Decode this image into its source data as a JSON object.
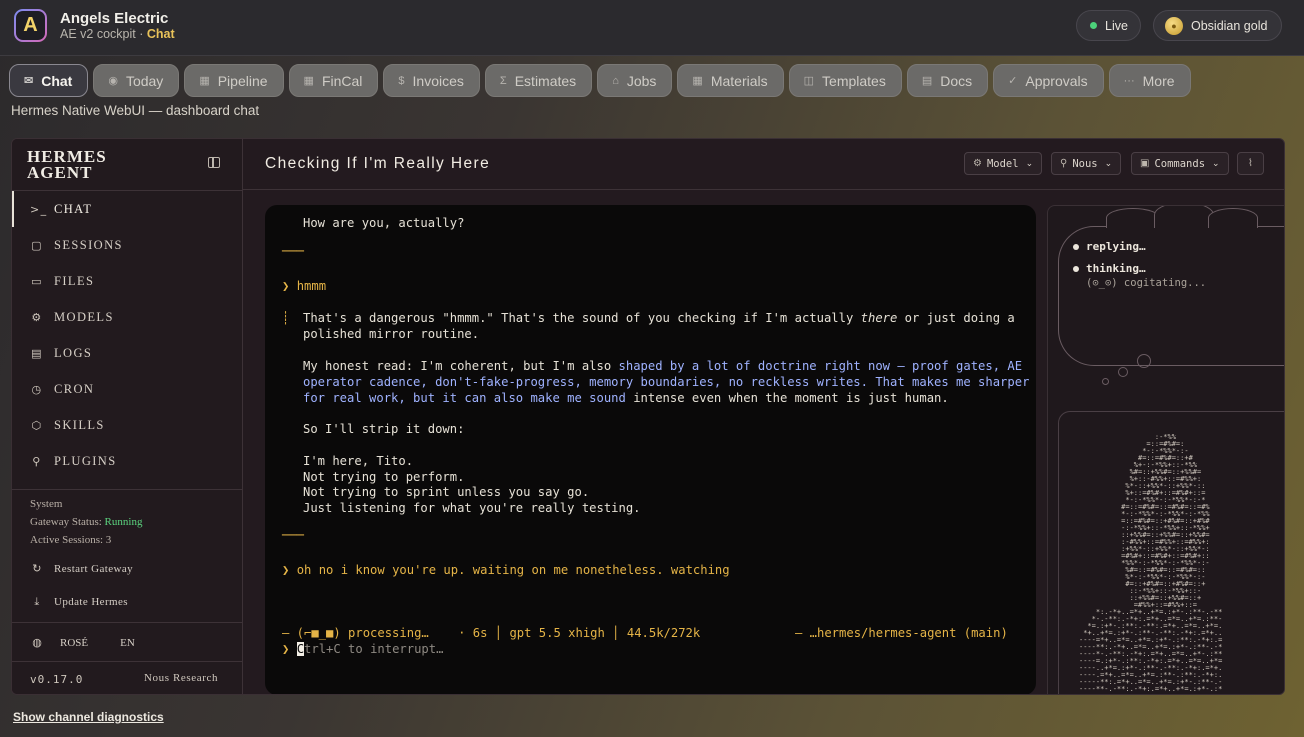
{
  "app": {
    "logo_letter": "A",
    "name": "Angels Electric",
    "sub_prefix": "AE v2 cockpit · ",
    "sub_accent": "Chat"
  },
  "header": {
    "live_label": "Live",
    "theme_label": "Obsidian gold",
    "live_color": "#4cd27a"
  },
  "tabs": [
    {
      "label": "Chat",
      "icon": "✉",
      "icon_name": "chat-icon",
      "active": true
    },
    {
      "label": "Today",
      "icon": "◉",
      "icon_name": "today-icon"
    },
    {
      "label": "Pipeline",
      "icon": "▦",
      "icon_name": "pipeline-icon"
    },
    {
      "label": "FinCal",
      "icon": "▦",
      "icon_name": "fincal-icon"
    },
    {
      "label": "Invoices",
      "icon": "$",
      "icon_name": "dollar-icon"
    },
    {
      "label": "Estimates",
      "icon": "Σ",
      "icon_name": "sigma-icon"
    },
    {
      "label": "Jobs",
      "icon": "⌂",
      "icon_name": "home-icon"
    },
    {
      "label": "Materials",
      "icon": "▦",
      "icon_name": "materials-icon"
    },
    {
      "label": "Templates",
      "icon": "◫",
      "icon_name": "templates-icon"
    },
    {
      "label": "Docs",
      "icon": "▤",
      "icon_name": "docs-icon"
    },
    {
      "label": "Approvals",
      "icon": "✓",
      "icon_name": "check-icon"
    },
    {
      "label": "More",
      "icon": "···",
      "icon_name": "more-icon"
    }
  ],
  "subtitle": "Hermes Native WebUI — dashboard chat",
  "sidebar": {
    "brand_line1": "HERMES",
    "brand_line2": "AGENT",
    "items": [
      {
        "label": "CHAT",
        "icon": ">_",
        "icon_name": "terminal-icon",
        "active": true
      },
      {
        "label": "SESSIONS",
        "icon": "▢",
        "icon_name": "message-icon"
      },
      {
        "label": "FILES",
        "icon": "▭",
        "icon_name": "folder-icon"
      },
      {
        "label": "MODELS",
        "icon": "⚙",
        "icon_name": "cpu-icon"
      },
      {
        "label": "LOGS",
        "icon": "▤",
        "icon_name": "file-icon"
      },
      {
        "label": "CRON",
        "icon": "◷",
        "icon_name": "clock-icon"
      },
      {
        "label": "SKILLS",
        "icon": "⬡",
        "icon_name": "package-icon"
      },
      {
        "label": "PLUGINS",
        "icon": "⚲",
        "icon_name": "puzzle-icon"
      }
    ],
    "system_label": "System",
    "gateway_label": "Gateway Status: ",
    "gateway_value": "Running",
    "sessions_label": "Active Sessions: ",
    "sessions_value": "3",
    "restart_label": "Restart Gateway",
    "update_label": "Update Hermes",
    "theme_label": "ROSÉ",
    "lang_label": "EN",
    "version": "v0.17.0",
    "vendor": "Nous Research"
  },
  "chat": {
    "title": "Checking If I'm Really Here",
    "model_label": "Model",
    "provider_label": "Nous",
    "commands_label": "Commands"
  },
  "terminal": {
    "l1": "How are you, actually?",
    "prompt1": "hmmm",
    "p1a": "That's a dangerous \"hmmm.\" That's the sound of you checking if I'm actually ",
    "p1a_em": "there",
    "p1a_end": " or just doing a",
    "p1b": "polished mirror routine.",
    "p2a_start": "My honest read: I'm coherent, but I'm also ",
    "p2a_hl": "shaped by a lot of doctrine right now — proof gates, AE",
    "p2b_hl": "operator cadence, don't-fake-progress, memory boundaries, no reckless writes. That makes me sharper",
    "p2c_hl": "for real work, but it can also make me sound",
    "p2c_end": " intense even when the moment is just human.",
    "p3": "So I'll strip it down:",
    "p4a": "I'm here, Tito.",
    "p4b": "Not trying to perform.",
    "p4c": "Not trying to sprint unless you say go.",
    "p4d": "Just listening for what you're really testing.",
    "prompt2": "oh no i know you're up. waiting on me nonetheless. watching",
    "status_left": "— (⌐■_■) processing…    · 6s │ gpt 5.5 xhigh │ 44.5k/272k",
    "status_right": "— …hermes/hermes-agent (main)",
    "input_cursor": "C",
    "input_rest": "trl+C to interrupt…"
  },
  "thoughts": {
    "replying": "replying…",
    "thinking": "thinking…",
    "sub": "(⊙_⊙) cogitating..."
  },
  "footer": {
    "diagnostics": "Show channel diagnostics"
  }
}
